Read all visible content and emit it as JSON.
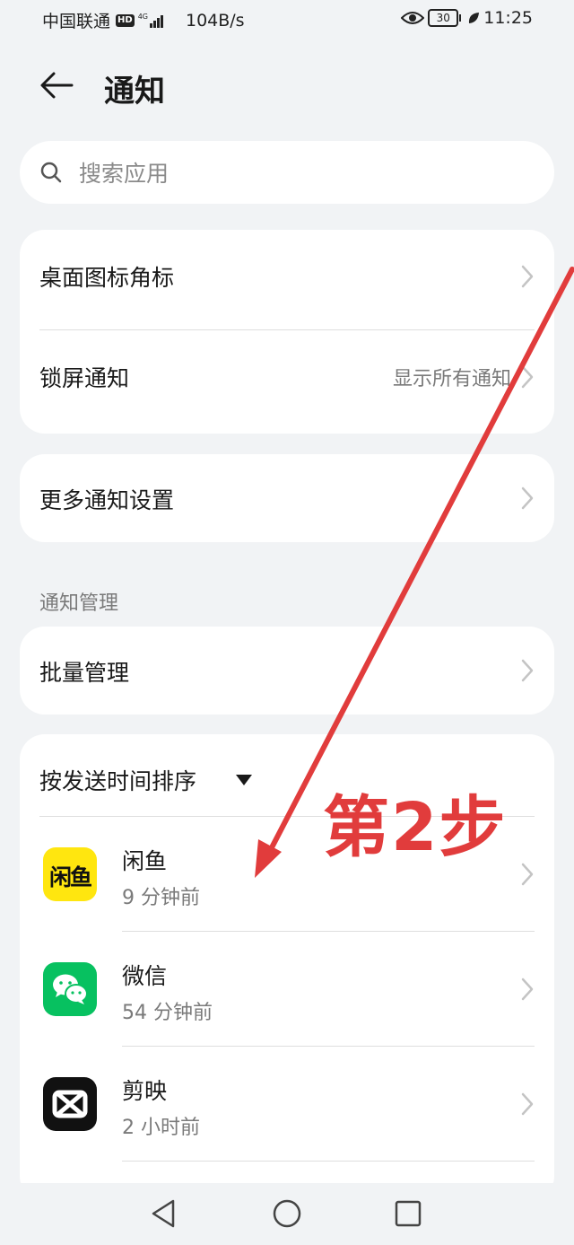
{
  "status_bar": {
    "carrier": "中国联通",
    "hd": "HD",
    "network": "4G",
    "speed": "104B/s",
    "battery": "30",
    "time": "11:25"
  },
  "header": {
    "title": "通知"
  },
  "search": {
    "placeholder": "搜索应用"
  },
  "settings_card1": [
    {
      "label": "桌面图标角标",
      "value": ""
    },
    {
      "label": "锁屏通知",
      "value": "显示所有通知"
    }
  ],
  "settings_card2": {
    "label": "更多通知设置"
  },
  "section_title": "通知管理",
  "batch": {
    "label": "批量管理"
  },
  "sort": {
    "label": "按发送时间排序"
  },
  "apps": [
    {
      "name": "闲鱼",
      "time": "9 分钟前",
      "icon_text": "闲鱼"
    },
    {
      "name": "微信",
      "time": "54 分钟前"
    },
    {
      "name": "剪映",
      "time": "2 小时前"
    }
  ],
  "annotation": "第2步",
  "colors": {
    "background": "#f1f3f5",
    "card": "#ffffff",
    "annotation_red": "#e13c3c",
    "xianyu_yellow": "#ffe60f",
    "wechat_green": "#07c160",
    "capcut_black": "#111111"
  },
  "icons": [
    "back-arrow-icon",
    "search-icon",
    "chevron-right-icon",
    "caret-down-icon",
    "eye-icon",
    "leaf-icon",
    "nav-back-icon",
    "nav-home-icon",
    "nav-recents-icon"
  ]
}
